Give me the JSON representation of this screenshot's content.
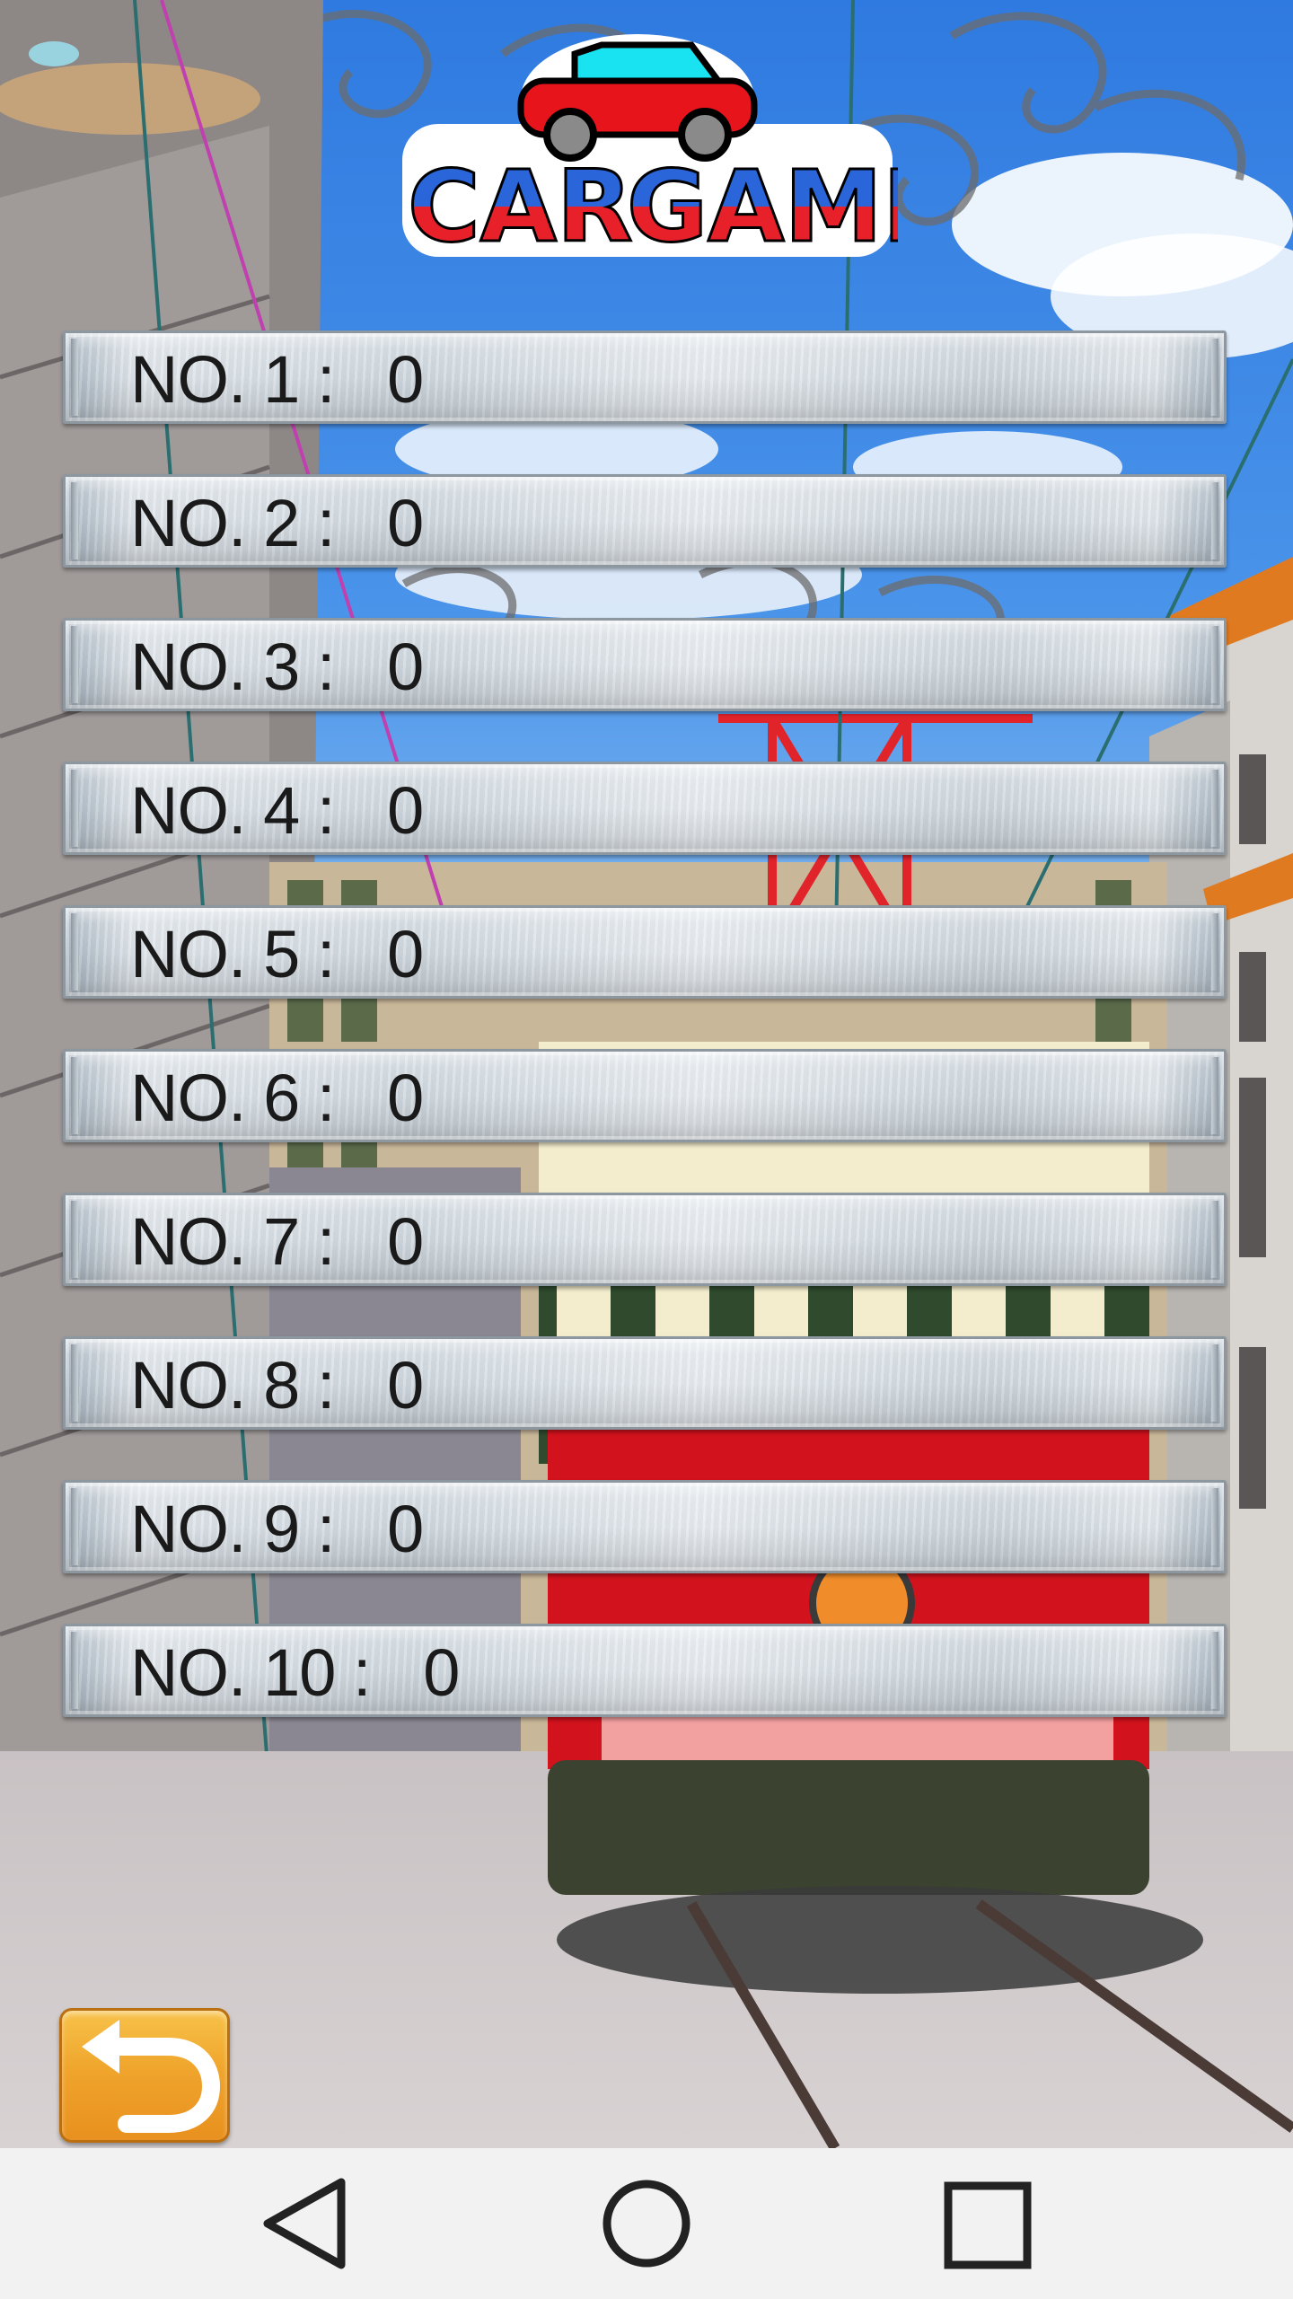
{
  "app": {
    "logo": {
      "line1": "CAR",
      "line2": "GAME"
    }
  },
  "scores": [
    {
      "label": "NO. 1 :",
      "value": "0"
    },
    {
      "label": "NO. 2 :",
      "value": "0"
    },
    {
      "label": "NO. 3 :",
      "value": "0"
    },
    {
      "label": "NO. 4 :",
      "value": "0"
    },
    {
      "label": "NO. 5 :",
      "value": "0"
    },
    {
      "label": "NO. 6 :",
      "value": "0"
    },
    {
      "label": "NO. 7 :",
      "value": "0"
    },
    {
      "label": "NO. 8 :",
      "value": "0"
    },
    {
      "label": "NO. 9 :",
      "value": "0"
    },
    {
      "label": "NO. 10 :",
      "value": "0"
    }
  ],
  "controls": {
    "back_icon": "undo-arrow-icon"
  },
  "nav_bar": {
    "back_icon": "triangle-back-icon",
    "home_icon": "circle-home-icon",
    "recents_icon": "square-recents-icon"
  },
  "colors": {
    "back_button": "#f0a52c",
    "logo_red": "#e8202a",
    "logo_blue": "#2a66d9",
    "car_body": "#e8141c",
    "car_window": "#19e3f0",
    "nav_bar": "#f2f2f2"
  }
}
